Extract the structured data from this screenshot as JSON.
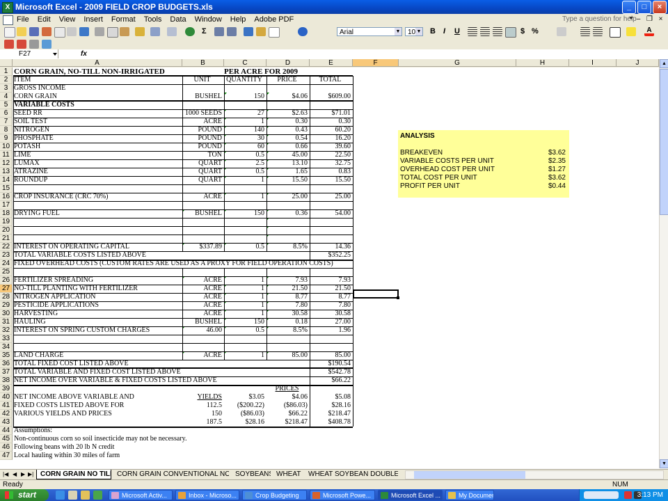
{
  "window": {
    "title": "Microsoft Excel - 2009 FIELD CROP BUDGETS.xls"
  },
  "menu": [
    "File",
    "Edit",
    "View",
    "Insert",
    "Format",
    "Tools",
    "Data",
    "Window",
    "Help",
    "Adobe PDF"
  ],
  "help_box": {
    "placeholder": "Type a question for help"
  },
  "toolbar": {
    "font_name": "Arial",
    "font_size": "10",
    "bold": "B",
    "italic": "I",
    "underline": "U",
    "percent": "%",
    "currency": "$",
    "sigma": "Σ"
  },
  "formula_bar": {
    "name_box": "F27",
    "fx": "fx",
    "content": ""
  },
  "columns": [
    "A",
    "B",
    "C",
    "D",
    "E",
    "F",
    "G",
    "H",
    "I",
    "J"
  ],
  "selected_cell": "F27",
  "rows": [
    {
      "n": "1",
      "a": "CORN GRAIN, NO-TILL NON-IRRIGATED",
      "b": "",
      "c": "PER ACRE FOR 2009",
      "d": "",
      "e": ""
    },
    {
      "n": "2",
      "a": "ITEM",
      "b": "UNIT",
      "c": "QUANTITY",
      "d": "PRICE",
      "e": "TOTAL"
    },
    {
      "n": "3",
      "a": "GROSS INCOME",
      "b": "",
      "c": "",
      "d": "",
      "e": ""
    },
    {
      "n": "4",
      "a": "CORN GRAIN",
      "b": "BUSHEL",
      "c": "150",
      "d": "$4.06",
      "e": "$609.00"
    },
    {
      "n": "5",
      "a": "VARIABLE COSTS",
      "b": "",
      "c": "",
      "d": "",
      "e": ""
    },
    {
      "n": "6",
      "a": "SEED RR",
      "b": "1000 SEEDS",
      "c": "27",
      "d": "$2.63",
      "e": "$71.01"
    },
    {
      "n": "7",
      "a": "SOIL TEST",
      "b": "ACRE",
      "c": "1",
      "d": "0.30",
      "e": "0.30"
    },
    {
      "n": "8",
      "a": "NITROGEN",
      "b": "POUND",
      "c": "140",
      "d": "0.43",
      "e": "60.20"
    },
    {
      "n": "9",
      "a": "PHOSPHATE",
      "b": "POUND",
      "c": "30",
      "d": "0.54",
      "e": "16.20"
    },
    {
      "n": "10",
      "a": "POTASH",
      "b": "POUND",
      "c": "60",
      "d": "0.66",
      "e": "39.60"
    },
    {
      "n": "11",
      "a": "LIME",
      "b": "TON",
      "c": "0.5",
      "d": "45.00",
      "e": "22.50"
    },
    {
      "n": "12",
      "a": "LUMAX",
      "b": "QUART",
      "c": "2.5",
      "d": "13.10",
      "e": "32.75"
    },
    {
      "n": "13",
      "a": "ATRAZINE",
      "b": "QUART",
      "c": "0.5",
      "d": "1.65",
      "e": "0.83"
    },
    {
      "n": "14",
      "a": "ROUNDUP",
      "b": "QUART",
      "c": "1",
      "d": "15.50",
      "e": "15.50"
    },
    {
      "n": "15",
      "a": "",
      "b": "",
      "c": "",
      "d": "",
      "e": ""
    },
    {
      "n": "16",
      "a": "CROP INSURANCE (CRC 70%)",
      "b": "ACRE",
      "c": "1",
      "d": "25.00",
      "e": "25.00"
    },
    {
      "n": "17",
      "a": "",
      "b": "",
      "c": "",
      "d": "",
      "e": ""
    },
    {
      "n": "18",
      "a": "DRYING FUEL",
      "b": "BUSHEL",
      "c": "150",
      "d": "0.36",
      "e": "54.00"
    },
    {
      "n": "19",
      "a": "",
      "b": "",
      "c": "",
      "d": "",
      "e": ""
    },
    {
      "n": "20",
      "a": "",
      "b": "",
      "c": "",
      "d": "",
      "e": ""
    },
    {
      "n": "21",
      "a": "",
      "b": "",
      "c": "",
      "d": "",
      "e": ""
    },
    {
      "n": "22",
      "a": "INTEREST ON OPERATING CAPITAL",
      "b": "$337.89",
      "c": "0.5",
      "d": "8.5%",
      "e": "14.36"
    },
    {
      "n": "23",
      "a": "TOTAL VARIABLE COSTS LISTED ABOVE",
      "b": "",
      "c": "",
      "d": "",
      "e": "$352.25"
    },
    {
      "n": "24",
      "a": "FIXED OVERHEAD COSTS (CUSTOM RATES ARE USED AS A PROXY FOR FIELD OPERATION COSTS)",
      "b": "",
      "c": "",
      "d": "",
      "e": ""
    },
    {
      "n": "25",
      "a": "",
      "b": "",
      "c": "",
      "d": "",
      "e": ""
    },
    {
      "n": "26",
      "a": "FERTILIZER SPREADING",
      "b": "ACRE",
      "c": "1",
      "d": "7.93",
      "e": "7.93"
    },
    {
      "n": "27",
      "a": "NO-TILL PLANTING WITH FERTILIZER",
      "b": "ACRE",
      "c": "1",
      "d": "21.50",
      "e": "21.50"
    },
    {
      "n": "28",
      "a": "NITROGEN APPLICATION",
      "b": "ACRE",
      "c": "1",
      "d": "8.77",
      "e": "8.77"
    },
    {
      "n": "29",
      "a": "PESTICIDE APPLICATIONS",
      "b": "ACRE",
      "c": "1",
      "d": "7.80",
      "e": "7.80"
    },
    {
      "n": "30",
      "a": "HARVESTING",
      "b": "ACRE",
      "c": "1",
      "d": "30.58",
      "e": "30.58"
    },
    {
      "n": "31",
      "a": "HAULING",
      "b": "BUSHEL",
      "c": "150",
      "d": "0.18",
      "e": "27.00"
    },
    {
      "n": "32",
      "a": "INTEREST ON SPRING CUSTOM CHARGES",
      "b": "46.00",
      "c": "0.5",
      "d": "8.5%",
      "e": "1.96"
    },
    {
      "n": "33",
      "a": "",
      "b": "",
      "c": "",
      "d": "",
      "e": ""
    },
    {
      "n": "34",
      "a": "",
      "b": "",
      "c": "",
      "d": "",
      "e": ""
    },
    {
      "n": "35",
      "a": "LAND CHARGE",
      "b": "ACRE",
      "c": "1",
      "d": "85.00",
      "e": "85.00"
    },
    {
      "n": "36",
      "a": "TOTAL FIXED COST LISTED ABOVE",
      "b": "",
      "c": "",
      "d": "",
      "e": "$190.54"
    },
    {
      "n": "37",
      "a": "TOTAL VARIABLE AND FIXED COST LISTED ABOVE",
      "b": "",
      "c": "",
      "d": "",
      "e": "$542.78"
    },
    {
      "n": "38",
      "a": "NET INCOME OVER VARIABLE & FIXED COSTS LISTED ABOVE",
      "b": "",
      "c": "",
      "d": "",
      "e": "$66.22"
    },
    {
      "n": "39",
      "a": "",
      "b": "",
      "c": "",
      "d": "PRICES",
      "e": ""
    },
    {
      "n": "40",
      "a": "NET INCOME ABOVE VARIABLE AND",
      "b": "YIELDS",
      "c": "$3.05",
      "d": "$4.06",
      "e": "$5.08"
    },
    {
      "n": "41",
      "a": "FIXED COSTS LISTED ABOVE FOR",
      "b": "112.5",
      "c": "($200.22)",
      "d": "($86.03)",
      "e": "$28.16"
    },
    {
      "n": "42",
      "a": "VARIOUS YIELDS AND PRICES",
      "b": "150",
      "c": "($86.03)",
      "d": "$66.22",
      "e": "$218.47"
    },
    {
      "n": "43",
      "a": "",
      "b": "187.5",
      "c": "$28.16",
      "d": "$218.47",
      "e": "$408.78"
    },
    {
      "n": "44",
      "a": "Assumptions:",
      "b": "",
      "c": "",
      "d": "",
      "e": ""
    },
    {
      "n": "45",
      "a": "Non-continuous corn so soil insecticide may not be necessary.",
      "b": "",
      "c": "",
      "d": "",
      "e": ""
    },
    {
      "n": "46",
      "a": "Following beans with 20 lb N credit",
      "b": "",
      "c": "",
      "d": "",
      "e": ""
    },
    {
      "n": "47",
      "a": "Local hauling within 30 miles of farm",
      "b": "",
      "c": "",
      "d": "",
      "e": ""
    }
  ],
  "analysis": {
    "heading": "ANALYSIS",
    "items": [
      {
        "label": "BREAKEVEN",
        "value": "$3.62"
      },
      {
        "label": "VARIABLE COSTS PER UNIT",
        "value": "$2.35"
      },
      {
        "label": "OVERHEAD COST PER UNIT",
        "value": "$1.27"
      },
      {
        "label": "TOTAL COST PER UNIT",
        "value": "$3.62"
      },
      {
        "label": "PROFIT PER UNIT",
        "value": "$0.44"
      }
    ]
  },
  "sheet_tabs": [
    "CORN GRAIN NO TILL",
    "CORN GRAIN CONVENTIONAL NON-IR",
    "SOYBEANS",
    "WHEAT",
    "WHEAT SOYBEAN DOUBLE CR("
  ],
  "status": {
    "left": "Ready",
    "num": "NUM"
  },
  "taskbar": {
    "start": "start",
    "tasks": [
      "Microsoft Activ...",
      "Inbox - Microso...",
      "Crop Budgeting",
      "Microsoft Powe...",
      "Microsoft Excel ...",
      "My Documents"
    ],
    "clock": "3:13 PM"
  },
  "colors": {
    "analysis_bg": "#ffff99",
    "selected_header": "#f8c879",
    "titlebar": "#0a5ee6",
    "taskbar": "#2a5bd0"
  }
}
